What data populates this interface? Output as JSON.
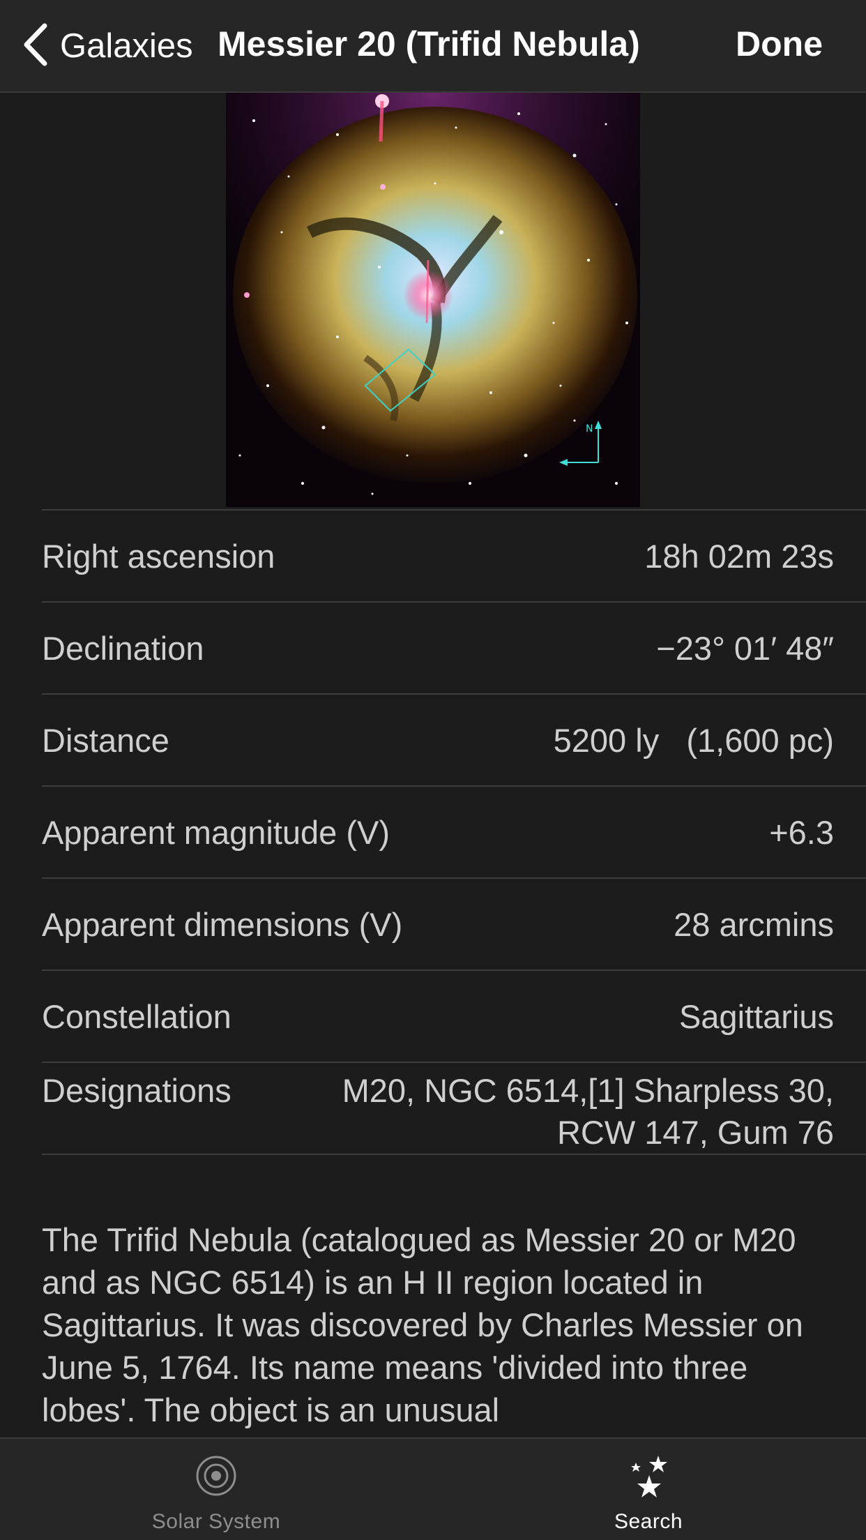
{
  "navbar": {
    "back_label": "Galaxies",
    "title": "Messier 20 (Trifid Nebula)",
    "done_label": "Done"
  },
  "image": {
    "compass_label": "N"
  },
  "info": {
    "right_ascension": {
      "label": "Right ascension",
      "value": "18h 02m 23s"
    },
    "declination": {
      "label": "Declination",
      "value": "−23° 01′ 48″"
    },
    "distance": {
      "label": "Distance",
      "value": "5200 ly   (1,600 pc)"
    },
    "magnitude": {
      "label": "Apparent magnitude (V)",
      "value": "+6.3"
    },
    "dimensions": {
      "label": "Apparent dimensions (V)",
      "value": "28 arcmins"
    },
    "constellation": {
      "label": "Constellation",
      "value": "Sagittarius"
    },
    "designations": {
      "label": "Designations",
      "value": "M20, NGC 6514,[1] Sharpless 30, RCW 147, Gum 76"
    }
  },
  "description": "The Trifid Nebula (catalogued as Messier 20 or M20 and as NGC 6514) is an H II region located in Sagittarius. It was discovered by Charles Messier on June 5, 1764. Its name means 'divided into three lobes'. The object is an unusual",
  "tabbar": {
    "solar_system": "Solar System",
    "search": "Search",
    "active": "search"
  },
  "colors": {
    "background": "#1c1c1c",
    "bar": "#262626",
    "text": "#cfcfcf",
    "inactive_tab": "#8e8e8e"
  }
}
